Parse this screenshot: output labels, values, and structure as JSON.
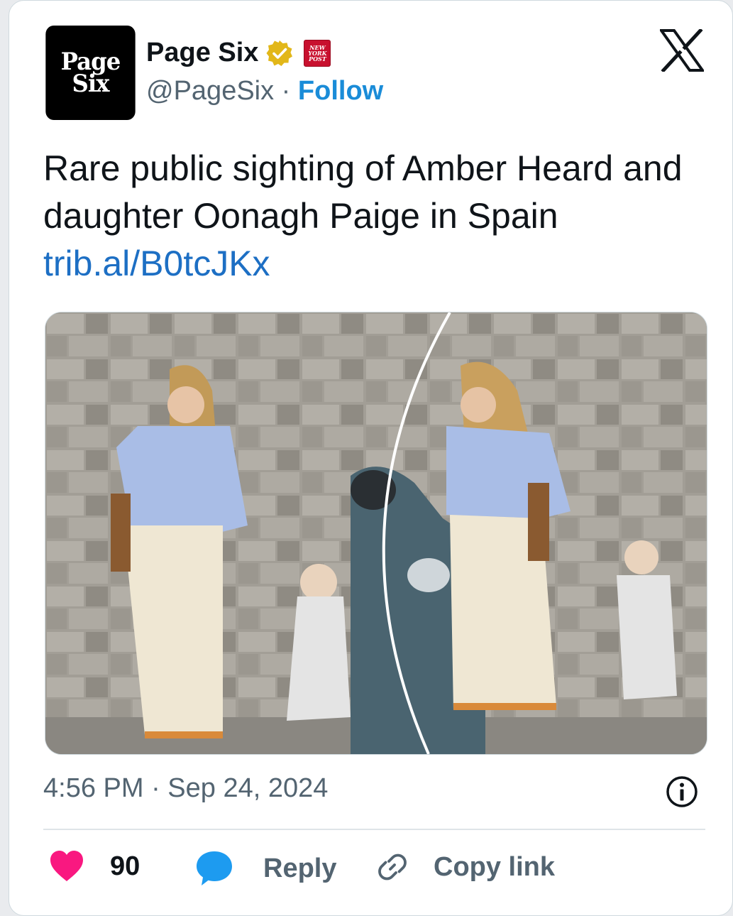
{
  "account": {
    "avatar_line1": "Page",
    "avatar_line2": "Six",
    "name": "Page Six",
    "affiliate_badge_text": [
      "NEW",
      "YORK",
      "POST"
    ],
    "handle": "@PageSix",
    "separator": " · ",
    "follow_label": "Follow"
  },
  "tweet": {
    "text": "Rare public sighting of Amber Heard and daughter Oonagh Paige in Spain",
    "link": "trib.al/B0tcJKx"
  },
  "meta": {
    "timestamp": "4:56 PM · Sep 24, 2024"
  },
  "actions": {
    "like_count": "90",
    "reply_label": "Reply",
    "copy_link_label": "Copy link"
  },
  "colors": {
    "verified_gold": "#e2b719",
    "link_blue": "#1d9bf0",
    "like_pink": "#f91880",
    "reply_blue": "#1d9bf0"
  },
  "icons": [
    "x-logo-icon",
    "verified-badge-icon",
    "info-icon",
    "heart-icon",
    "reply-bubble-icon",
    "link-icon"
  ]
}
